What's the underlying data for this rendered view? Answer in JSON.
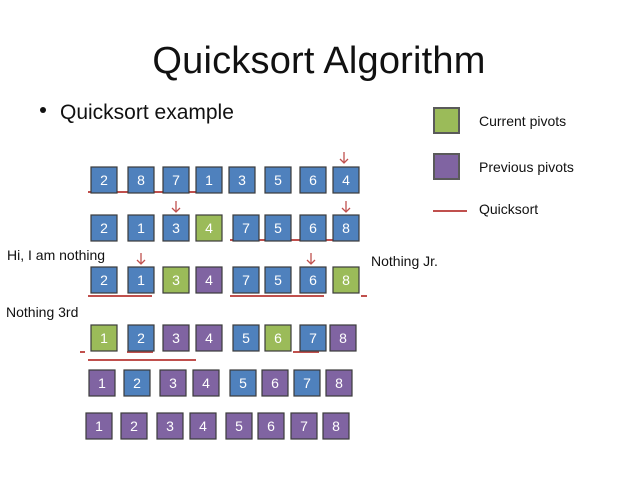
{
  "title": "Quicksort Algorithm",
  "bullet": "Quicksort example",
  "legend": {
    "current": {
      "label": "Current pivots",
      "color": "#9bbb59"
    },
    "previous": {
      "label": "Previous pivots",
      "color": "#8064a2"
    },
    "line": {
      "label": "Quicksort",
      "color": "#c0504d"
    }
  },
  "colors": {
    "unsorted": "#4f81bd",
    "border": "#3b3b3b",
    "arrow": "#c0504d"
  },
  "notes": {
    "n1": "Hi, I am nothing",
    "n2": "Nothing Jr.",
    "n3": "Nothing  3rd"
  },
  "rows": [
    [
      [
        "2",
        "u"
      ],
      [
        "8",
        "u"
      ],
      [
        "7",
        "u"
      ],
      [
        "1",
        "u"
      ],
      [
        "3",
        "u"
      ],
      [
        "5",
        "u"
      ],
      [
        "6",
        "u"
      ],
      [
        "4",
        "u"
      ]
    ],
    [
      [
        "2",
        "u"
      ],
      [
        "1",
        "u"
      ],
      [
        "3",
        "u"
      ],
      [
        "4",
        "c"
      ],
      [
        "7",
        "u"
      ],
      [
        "5",
        "u"
      ],
      [
        "6",
        "u"
      ],
      [
        "8",
        "u"
      ]
    ],
    [
      [
        "2",
        "u"
      ],
      [
        "1",
        "u"
      ],
      [
        "3",
        "c"
      ],
      [
        "4",
        "p"
      ],
      [
        "7",
        "u"
      ],
      [
        "5",
        "u"
      ],
      [
        "6",
        "u"
      ],
      [
        "8",
        "c"
      ]
    ],
    [
      [
        "1",
        "c"
      ],
      [
        "2",
        "u"
      ],
      [
        "3",
        "p"
      ],
      [
        "4",
        "p"
      ],
      [
        "5",
        "u"
      ],
      [
        "6",
        "c"
      ],
      [
        "7",
        "u"
      ],
      [
        "8",
        "p"
      ]
    ],
    [
      [
        "1",
        "p"
      ],
      [
        "2",
        "u"
      ],
      [
        "3",
        "p"
      ],
      [
        "4",
        "p"
      ],
      [
        "5",
        "u"
      ],
      [
        "6",
        "p"
      ],
      [
        "7",
        "u"
      ],
      [
        "8",
        "p"
      ]
    ],
    [
      [
        "1",
        "p"
      ],
      [
        "2",
        "p"
      ],
      [
        "3",
        "p"
      ],
      [
        "4",
        "p"
      ],
      [
        "5",
        "p"
      ],
      [
        "6",
        "p"
      ],
      [
        "7",
        "p"
      ],
      [
        "8",
        "p"
      ]
    ]
  ]
}
